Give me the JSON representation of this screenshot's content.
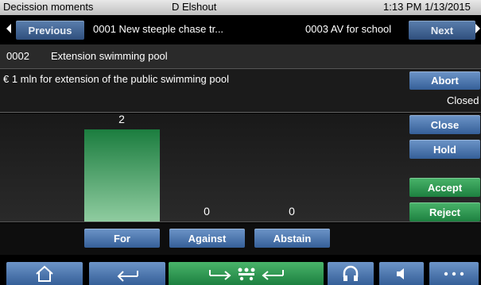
{
  "titlebar": {
    "app_title": "Decission moments",
    "user": "D Elshout",
    "datetime": "1:13 PM 1/13/2015"
  },
  "nav": {
    "previous_label": "Previous",
    "previous_item": "0001 New steeple chase tr...",
    "next_item": "0003 AV for school",
    "next_label": "Next"
  },
  "current_item": {
    "number": "0002",
    "title": "Extension swimming pool",
    "description": "€ 1 mln for extension of the public swimming pool"
  },
  "side_buttons": {
    "abort": "Abort",
    "status": "Closed",
    "close": "Close",
    "hold": "Hold",
    "accept": "Accept",
    "reject": "Reject"
  },
  "chart_data": {
    "type": "bar",
    "categories": [
      "For",
      "Against",
      "Abstain"
    ],
    "values": [
      2,
      0,
      0
    ],
    "value_labels": [
      "2",
      "0",
      "0"
    ],
    "ylim": [
      0,
      2
    ]
  },
  "vote_buttons": [
    "For",
    "Against",
    "Abstain"
  ],
  "footer": {
    "icons": [
      "home-icon",
      "back-arrow-icon",
      "forward-arrow-icon",
      "meeting-people-icon",
      "return-arrow-icon",
      "headphones-icon",
      "speaker-icon",
      "more-icon"
    ],
    "colors": {
      "blue": "#4a78b4",
      "green": "#2f9a53"
    }
  }
}
